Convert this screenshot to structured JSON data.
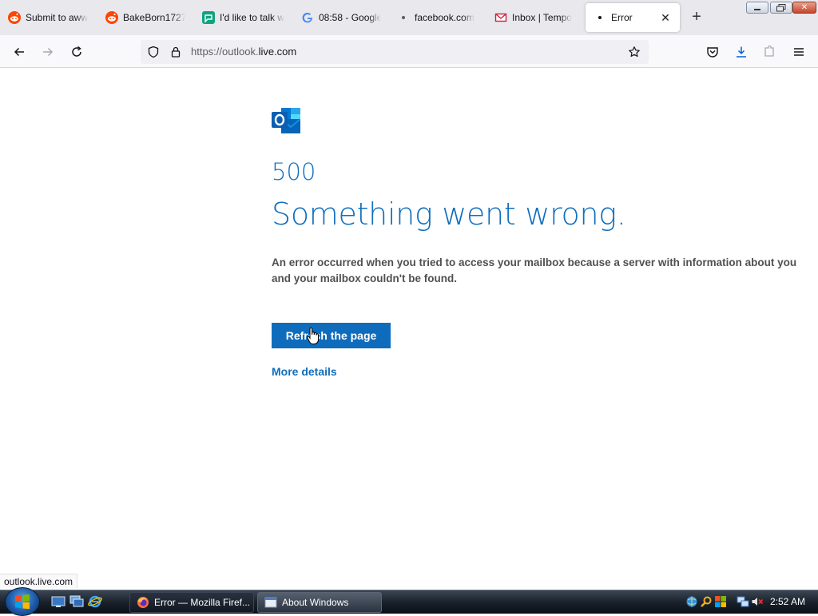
{
  "browser": {
    "tabs": [
      {
        "label": "Submit to aww",
        "icon": "reddit-icon"
      },
      {
        "label": "BakeBorn1727",
        "icon": "reddit-icon"
      },
      {
        "label": "I'd like to talk w",
        "icon": "chat-icon"
      },
      {
        "label": "08:58 - Google",
        "icon": "google-icon"
      },
      {
        "label": "facebook.com",
        "icon": "dot-icon"
      },
      {
        "label": "Inbox | Tempo",
        "icon": "mail-icon"
      },
      {
        "label": "Error",
        "icon": "dot-icon",
        "active": true
      }
    ],
    "url_prefix": "https://outlook.",
    "url_host": "live.com",
    "status_text": "outlook.live.com"
  },
  "page": {
    "error_code": "500",
    "title": "Something went wrong.",
    "message": "An error occurred when you tried to access your mailbox because a server with information about you and your mailbox couldn't be found.",
    "refresh_label": "Refresh the page",
    "more_label": "More details",
    "accent_color": "#106ebe"
  },
  "taskbar": {
    "windows": [
      {
        "label": "Error — Mozilla Firef...",
        "icon": "firefox-icon",
        "active": true
      },
      {
        "label": "About Windows",
        "icon": "window-icon",
        "active": false
      }
    ],
    "clock": "2:52 AM"
  }
}
